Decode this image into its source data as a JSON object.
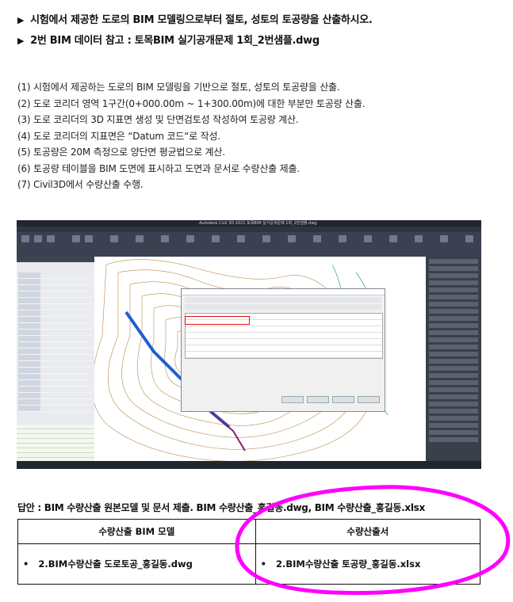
{
  "heading1": "시험에서 제공한 도로의 BIM 모델링으로부터 절토, 성토의 토공량을 산출하시오.",
  "heading2": "2번 BIM 데이터 참고 : 토목BIM 실기공개문제 1회_2번샘플.dwg",
  "items": [
    "(1) 시험에서 제공하는 도로의 BIM 모델링을 기반으로 절토, 성토의 토공량을 산출.",
    "(2) 도로 코리더 영역 1구간(0+000.00m ~ 1+300.00m)에 대한 부분만 토공량 산출.",
    "(3) 도로 코리더의 3D 지표면 생성 및 단면검토성 작성하여 토공량 계산.",
    "(4) 도로 코리더의 지표면은 “Datum 코드“로 작성.",
    "(5) 토공량은 20M 측정으로 양단면 평균법으로 계산.",
    "(6) 토공량 테이블을 BIM 도면에 표시하고 도면과 문서로 수량산출 제출.",
    "(7) Civil3D에서 수량산출 수행."
  ],
  "screenshot": {
    "window_title": "Autodesk Civil 3D 2021  토목BIM 실기공개문제 1회_2번샘플.dwg"
  },
  "answer": "답안 : BIM 수량산출 원본모델 및 문서 제출. BIM 수량산출_홍길동.dwg, BIM 수량산출_홍길동.xlsx",
  "table": {
    "headers": [
      "수량산출 BIM 모델",
      "수량산출서"
    ],
    "cells": [
      "2.BIM수량산출 도로토공_홍길동.dwg",
      "2.BIM수량산출 토공량_홍길동.xlsx"
    ]
  },
  "colors": {
    "highlight_oval": "#ff00ff",
    "redbox": "#e02020"
  }
}
